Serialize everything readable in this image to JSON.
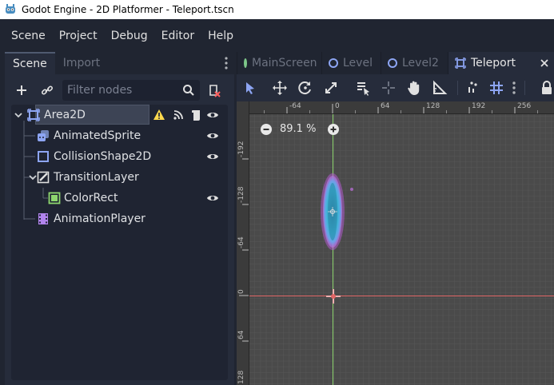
{
  "window": {
    "title": "Godot Engine - 2D Platformer - Teleport.tscn"
  },
  "menu": [
    "Scene",
    "Project",
    "Debug",
    "Editor",
    "Help"
  ],
  "dock": {
    "tabs": [
      "Scene",
      "Import"
    ],
    "filter_placeholder": "Filter nodes"
  },
  "tree": [
    {
      "label": "Area2D",
      "icon": "area2d-icon",
      "depth": 0,
      "selected": true
    },
    {
      "label": "AnimatedSprite",
      "icon": "animated-sprite-icon",
      "depth": 1
    },
    {
      "label": "CollisionShape2D",
      "icon": "collision-shape-icon",
      "depth": 1
    },
    {
      "label": "TransitionLayer",
      "icon": "canvas-layer-icon",
      "depth": 1
    },
    {
      "label": "ColorRect",
      "icon": "color-rect-icon",
      "depth": 2
    },
    {
      "label": "AnimationPlayer",
      "icon": "animation-player-icon",
      "depth": 1
    }
  ],
  "editor": {
    "tabs": [
      {
        "label": "MainScreen"
      },
      {
        "label": "Level"
      },
      {
        "label": "Level2"
      },
      {
        "label": "Teleport"
      }
    ],
    "zoom": "89.1 %",
    "ruler_top": [
      "-64",
      "0",
      "64",
      "128",
      "192",
      "256"
    ],
    "ruler_left": [
      "-192",
      "-128",
      "-64",
      "0",
      "64",
      "128"
    ]
  },
  "colors": {
    "accent": "#8da5f3",
    "warning": "#ffd94d",
    "axis_x": "#e06666",
    "axis_y": "#8ed66f",
    "portal": "#3fb7d8"
  }
}
